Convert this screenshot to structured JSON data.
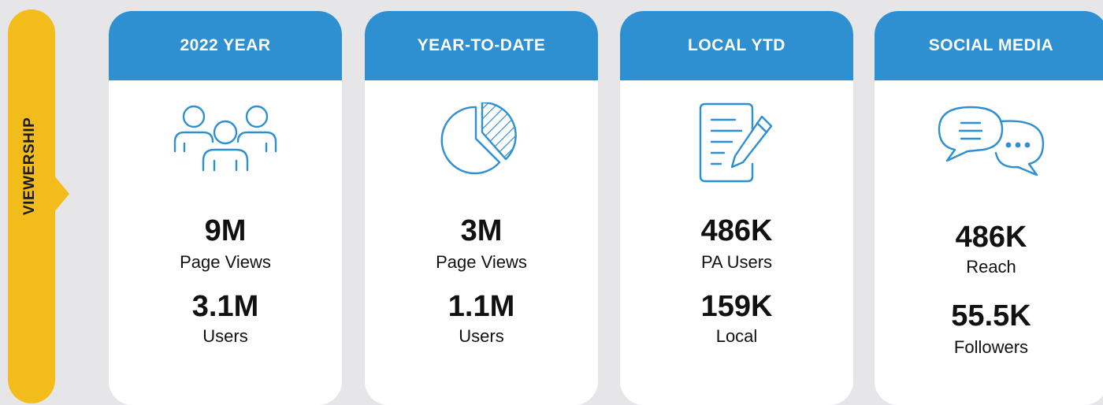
{
  "sidebar": {
    "label": "VIEWERSHIP"
  },
  "colors": {
    "accent_blue": "#2e8fd1",
    "side_yellow": "#f2bd1a",
    "background": "#e6e6e8"
  },
  "cards": [
    {
      "title": "2022 YEAR",
      "icon": "people-group-icon",
      "stats": [
        {
          "value": "9M",
          "label": "Page Views"
        },
        {
          "value": "3.1M",
          "label": "Users"
        }
      ]
    },
    {
      "title": "YEAR-TO-DATE",
      "icon": "pie-chart-icon",
      "stats": [
        {
          "value": "3M",
          "label": "Page Views"
        },
        {
          "value": "1.1M",
          "label": "Users"
        }
      ]
    },
    {
      "title": "LOCAL YTD",
      "icon": "document-edit-icon",
      "stats": [
        {
          "value": "486K",
          "label": "PA Users"
        },
        {
          "value": "159K",
          "label": "Local"
        }
      ]
    },
    {
      "title": "SOCIAL MEDIA",
      "icon": "chat-bubbles-icon",
      "stats": [
        {
          "value": "486K",
          "label": "Reach"
        },
        {
          "value": "55.5K",
          "label": "Followers"
        }
      ]
    }
  ]
}
